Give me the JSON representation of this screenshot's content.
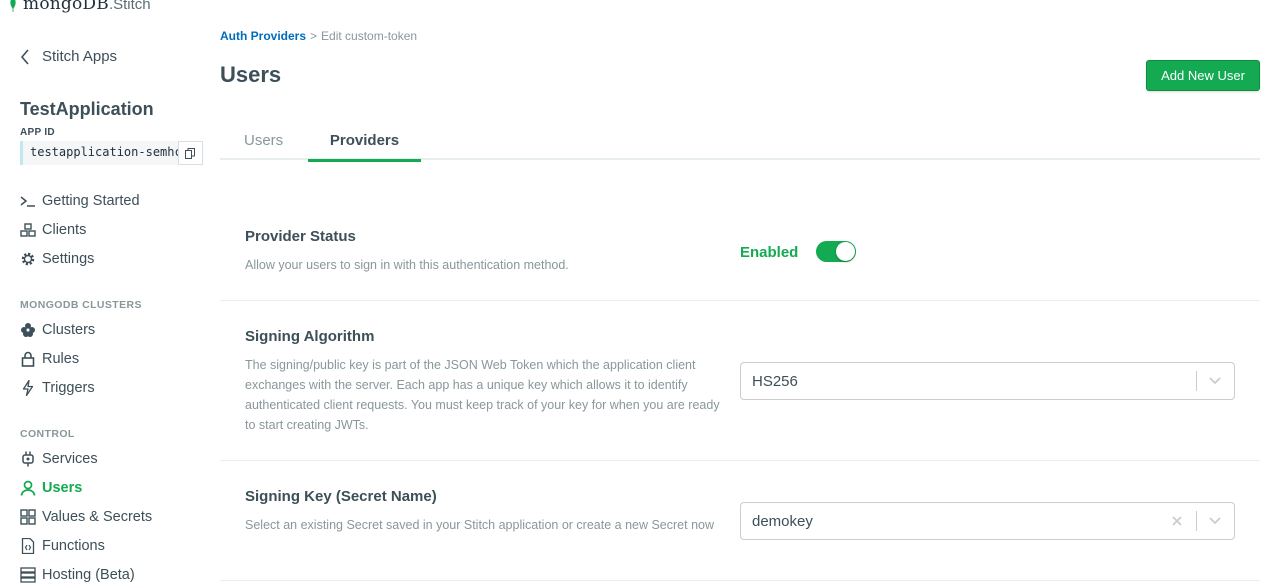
{
  "logo": {
    "brand": "mongoDB",
    "product": ".Stitch"
  },
  "sidebar": {
    "back_label": "Stitch Apps",
    "app_name": "TestApplication",
    "app_id_label": "APP ID",
    "app_id_value": "testapplication-semhc",
    "items_top": [
      {
        "label": "Getting Started",
        "icon": "terminal-icon"
      },
      {
        "label": "Clients",
        "icon": "clients-icon"
      },
      {
        "label": "Settings",
        "icon": "gear-icon"
      }
    ],
    "section_clusters": "MONGODB CLUSTERS",
    "items_clusters": [
      {
        "label": "Clusters",
        "icon": "clusters-icon"
      },
      {
        "label": "Rules",
        "icon": "lock-icon"
      },
      {
        "label": "Triggers",
        "icon": "bolt-icon"
      }
    ],
    "section_control": "CONTROL",
    "items_control": [
      {
        "label": "Services",
        "icon": "plug-icon"
      },
      {
        "label": "Users",
        "icon": "user-icon",
        "active": true
      },
      {
        "label": "Values & Secrets",
        "icon": "grid-icon"
      },
      {
        "label": "Functions",
        "icon": "function-icon"
      },
      {
        "label": "Hosting (Beta)",
        "icon": "server-icon"
      }
    ]
  },
  "breadcrumb": {
    "link": "Auth Providers",
    "separator": ">",
    "current": "Edit custom-token"
  },
  "page": {
    "title": "Users",
    "add_button": "Add New User"
  },
  "tabs": [
    {
      "label": "Users"
    },
    {
      "label": "Providers",
      "active": true
    }
  ],
  "provider_status": {
    "title": "Provider Status",
    "description": "Allow your users to sign in with this authentication method.",
    "status": "Enabled",
    "enabled": true
  },
  "signing_algorithm": {
    "title": "Signing Algorithm",
    "description": "The signing/public key is part of the JSON Web Token which the application client exchanges with the server. Each app has a unique key which allows it to identify authenticated client requests. You must keep track of your key for when you are ready to start creating JWTs.",
    "value": "HS256"
  },
  "signing_key": {
    "title": "Signing Key (Secret Name)",
    "description": "Select an existing Secret saved in your Stitch application or create a new Secret now",
    "value": "demokey"
  },
  "colors": {
    "accent": "#13aa52",
    "link": "#006cbc",
    "muted": "#89979b",
    "text": "#3d4f58"
  }
}
